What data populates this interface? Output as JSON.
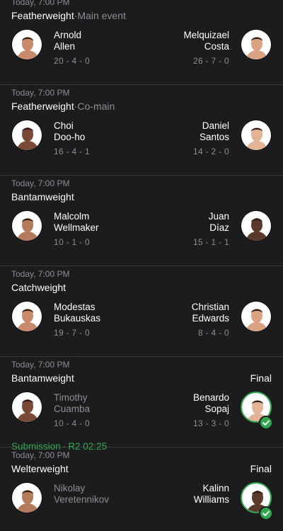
{
  "fights": [
    {
      "time": "Today, 7:00 PM",
      "weight_class": "Featherweight",
      "billing": "Main event",
      "status": "",
      "left": {
        "first": "Arnold",
        "last": "Allen",
        "record": "20 - 4 - 0"
      },
      "right": {
        "first": "Melquizael",
        "last": "Costa",
        "record": "26 - 7 - 0"
      }
    },
    {
      "time": "Today, 7:00 PM",
      "weight_class": "Featherweight",
      "billing": "Co-main",
      "status": "",
      "left": {
        "first": "Choi",
        "last": "Doo-ho",
        "record": "16 - 4 - 1"
      },
      "right": {
        "first": "Daniel",
        "last": "Santos",
        "record": "14 - 2 - 0"
      }
    },
    {
      "time": "Today, 7:00 PM",
      "weight_class": "Bantamweight",
      "billing": "",
      "status": "",
      "left": {
        "first": "Malcolm",
        "last": "Wellmaker",
        "record": "10 - 1 - 0"
      },
      "right": {
        "first": "Juan",
        "last": "Díaz",
        "record": "15 - 1 - 1"
      }
    },
    {
      "time": "Today, 7:00 PM",
      "weight_class": "Catchweight",
      "billing": "",
      "status": "",
      "left": {
        "first": "Modestas",
        "last": "Bukauskas",
        "record": "19 - 7 - 0"
      },
      "right": {
        "first": "Christian",
        "last": "Edwards",
        "record": "8 - 4 - 0"
      }
    },
    {
      "time": "Today, 7:00 PM",
      "weight_class": "Bantamweight",
      "billing": "",
      "status": "Final",
      "left": {
        "first": "Timothy",
        "last": "Cuamba",
        "record": "10 - 4 - 0"
      },
      "right": {
        "first": "Benardo",
        "last": "Sopaj",
        "record": "13 - 3 - 0"
      },
      "winner": "right",
      "result": {
        "method": "Submission",
        "detail": "R2 02:25"
      }
    },
    {
      "time": "Today, 7:00 PM",
      "weight_class": "Welterweight",
      "billing": "",
      "status": "Final",
      "left": {
        "first": "Nikolay",
        "last": "Veretennikov",
        "record": ""
      },
      "right": {
        "first": "Kalinn",
        "last": "Williams",
        "record": ""
      },
      "winner": "right"
    }
  ],
  "separator": "·",
  "icons": {
    "fighter_photo": "fighter-photo-icon",
    "winner_check": "checkmark-icon"
  },
  "colors": {
    "background": "#1c1c1e",
    "divider": "#3a3a3c",
    "secondary_text": "#8e8e93",
    "win_green": "#2ea84f"
  }
}
